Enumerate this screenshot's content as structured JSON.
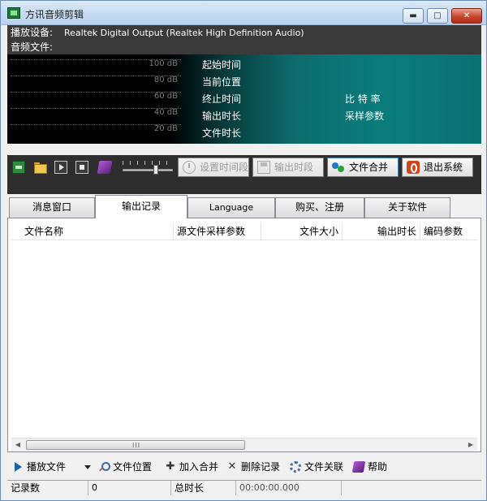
{
  "window": {
    "title": "方讯音频剪辑",
    "minimize_label": "▬",
    "maximize_label": "□",
    "close_label": "✕"
  },
  "info": {
    "device_label": "播放设备:",
    "device_value": "Realtek Digital Output (Realtek High Definition Audio)",
    "file_label": "音频文件:"
  },
  "display": {
    "db_levels": [
      "100 dB",
      "80 dB",
      "60 dB",
      "40 dB",
      "20 dB"
    ],
    "labels_left": [
      "起始时间",
      "当前位置",
      "终止时间",
      "输出时长",
      "文件时长"
    ],
    "labels_right": [
      "比 特 率",
      "采样参数"
    ]
  },
  "toolbar": {
    "volume_level": 0.68,
    "icons": [
      "record-icon",
      "open-folder-icon",
      "play-icon",
      "stop-icon",
      "help-book-icon"
    ],
    "set_range_label": "设置时间段",
    "output_range_label": "输出时段",
    "merge_label": "文件合并",
    "exit_label": "退出系统"
  },
  "tabs": [
    {
      "label": "消息窗口",
      "active": false
    },
    {
      "label": "输出记录",
      "active": true
    },
    {
      "label": "Language",
      "active": false
    },
    {
      "label": "购买、注册",
      "active": false
    },
    {
      "label": "关于软件",
      "active": false
    }
  ],
  "table": {
    "columns": [
      "文件名称",
      "源文件采样参数",
      "文件大小",
      "输出时长",
      "编码参数"
    ],
    "rows": [],
    "scroll_left": "◀",
    "scroll_right": "▶",
    "scroll_grip": "III"
  },
  "actions": {
    "play_file": "播放文件",
    "file_location": "文件位置",
    "add_merge": "加入合并",
    "add_icon_glyph": "✚",
    "delete_record": "删除记录",
    "delete_icon_glyph": "✕",
    "file_association": "文件关联",
    "help": "帮助"
  },
  "status": {
    "record_count_label": "记录数",
    "record_count_value": "0",
    "total_duration_label": "总时长",
    "total_duration_value": "00:00:00.000"
  }
}
